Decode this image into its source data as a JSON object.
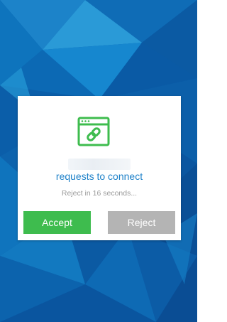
{
  "dialog": {
    "icon": "link-window-icon",
    "device_name": "",
    "request_text": "requests to connect",
    "countdown_text": "Reject in 16 seconds...",
    "accept_label": "Accept",
    "reject_label": "Reject"
  },
  "colors": {
    "accent_green": "#3ebc4e",
    "link_blue": "#1f82c9",
    "reject_gray": "#b4b4b4",
    "wallpaper_blue": "#0a5fae"
  }
}
